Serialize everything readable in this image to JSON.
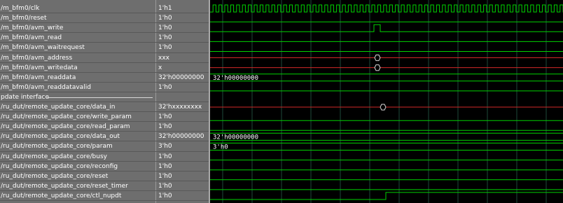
{
  "colors": {
    "panel": "#6e6e6e",
    "wave_bg": "#000000",
    "signal_green": "#00d200",
    "signal_red": "#d22828",
    "grid": "#1e4a3a",
    "text": "#ffffff"
  },
  "signals": [
    {
      "name": "/m_bfm0/clk",
      "value": "1'h1",
      "wave": "clock"
    },
    {
      "name": "/m_bfm0/reset",
      "value": "1'h0",
      "wave": "low"
    },
    {
      "name": "/m_bfm0/avm_write",
      "value": "1'h0",
      "wave": "pulse"
    },
    {
      "name": "/m_bfm0/avm_read",
      "value": "1'h0",
      "wave": "low"
    },
    {
      "name": "/m_bfm0/avm_waitrequest",
      "value": "1'h0",
      "wave": "low"
    },
    {
      "name": "/m_bfm0/avm_address",
      "value": "xxx",
      "wave": "bus-x-transition"
    },
    {
      "name": "/m_bfm0/avm_writedata",
      "value": "x",
      "wave": "bus-x-transition"
    },
    {
      "name": "/m_bfm0/avm_readdata",
      "value": "32'h00000000",
      "wave": "bus",
      "bus_label": "32'h00000000"
    },
    {
      "name": "/m_bfm0/avm_readdatavalid",
      "value": "1'h0",
      "wave": "low"
    },
    {
      "name": "pdate interface",
      "value": "",
      "wave": "group"
    },
    {
      "name": "/ru_dut/remote_update_core/data_in",
      "value": "32'hxxxxxxxx",
      "wave": "bus-x-transition2"
    },
    {
      "name": "/ru_dut/remote_update_core/write_param",
      "value": "1'h0",
      "wave": "low"
    },
    {
      "name": "/ru_dut/remote_update_core/read_param",
      "value": "1'h0",
      "wave": "low"
    },
    {
      "name": "/ru_dut/remote_update_core/data_out",
      "value": "32'h00000000",
      "wave": "bus",
      "bus_label": "32'h00000000"
    },
    {
      "name": "/ru_dut/remote_update_core/param",
      "value": "3'h0",
      "wave": "bus",
      "bus_label": "3'h0"
    },
    {
      "name": "/ru_dut/remote_update_core/busy",
      "value": "1'h0",
      "wave": "low"
    },
    {
      "name": "/ru_dut/remote_update_core/reconfig",
      "value": "1'h0",
      "wave": "low"
    },
    {
      "name": "/ru_dut/remote_update_core/reset",
      "value": "1'h0",
      "wave": "low"
    },
    {
      "name": "/ru_dut/remote_update_core/reset_timer",
      "value": "1'h0",
      "wave": "low"
    },
    {
      "name": "/ru_dut/remote_update_core/ctl_nupdt",
      "value": "1'h0",
      "wave": "rise"
    }
  ]
}
